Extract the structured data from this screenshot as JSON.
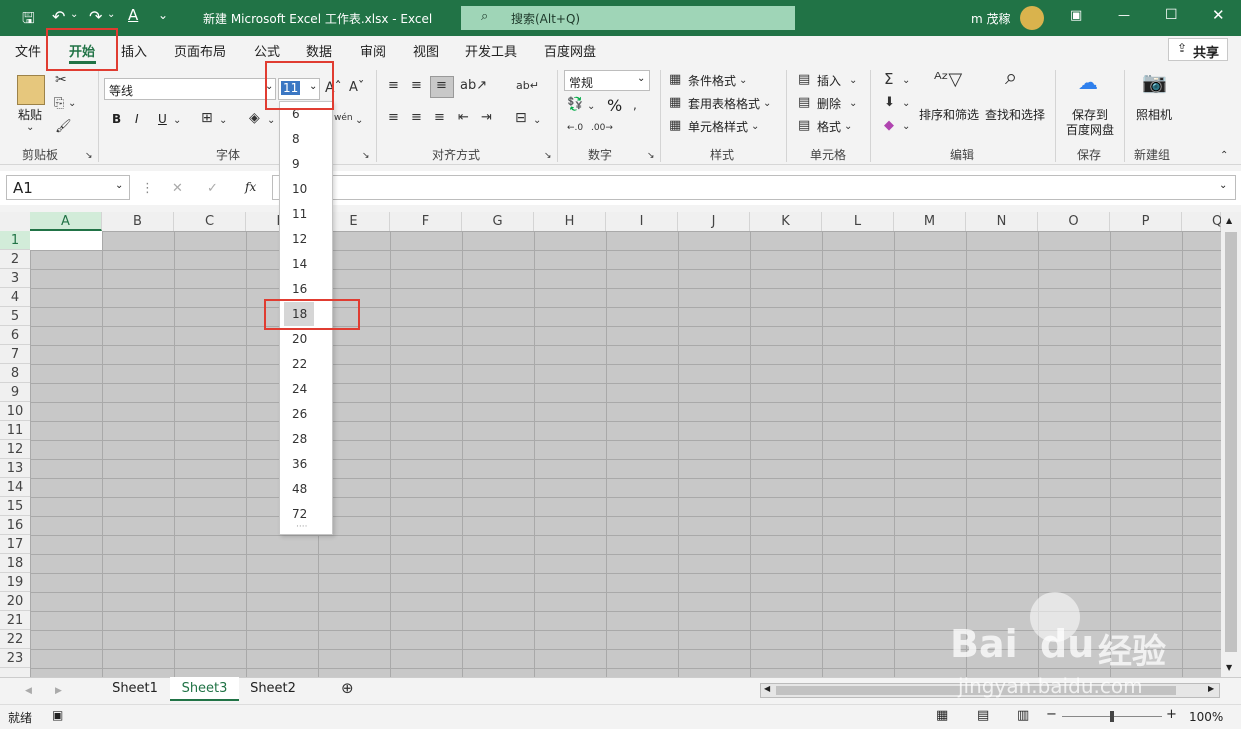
{
  "titlebar": {
    "title": "新建 Microsoft Excel 工作表.xlsx  -  Excel",
    "search_placeholder": "搜索(Alt+Q)",
    "user": "m 茂稼"
  },
  "menu": {
    "tabs": [
      "文件",
      "开始",
      "插入",
      "页面布局",
      "公式",
      "数据",
      "审阅",
      "视图",
      "开发工具",
      "百度网盘"
    ],
    "active": "开始",
    "share": "共享"
  },
  "ribbon": {
    "clipboard": {
      "paste": "粘贴",
      "group": "剪贴板"
    },
    "font": {
      "name": "等线",
      "size": "11",
      "group": "字体",
      "bold": "B",
      "italic": "I",
      "underline": "U"
    },
    "align": {
      "group": "对齐方式"
    },
    "number": {
      "format": "常规",
      "group": "数字",
      "percent": "%"
    },
    "styles": {
      "conditional": "条件格式",
      "table": "套用表格格式",
      "cell": "单元格样式",
      "group": "样式"
    },
    "cells": {
      "insert": "插入",
      "delete": "删除",
      "format": "格式",
      "group": "单元格"
    },
    "editing": {
      "sort": "排序和筛选",
      "find": "查找和选择",
      "group": "编辑"
    },
    "save": {
      "label1": "保存到",
      "label2": "百度网盘",
      "group": "保存"
    },
    "camera": {
      "label": "照相机",
      "group": "新建组"
    }
  },
  "formula": {
    "namebox": "A1",
    "fx": "fx"
  },
  "grid": {
    "columns": [
      "A",
      "B",
      "C",
      "D",
      "E",
      "F",
      "G",
      "H",
      "I",
      "J",
      "K",
      "L",
      "M",
      "N",
      "O",
      "P",
      "Q"
    ],
    "rows": [
      "1",
      "2",
      "3",
      "4",
      "5",
      "6",
      "7",
      "8",
      "9",
      "10",
      "11",
      "12",
      "13",
      "14",
      "15",
      "16",
      "17",
      "18",
      "19",
      "20",
      "21",
      "22",
      "23"
    ]
  },
  "font_size_dropdown": {
    "options": [
      "6",
      "8",
      "9",
      "10",
      "11",
      "12",
      "14",
      "16",
      "18",
      "20",
      "22",
      "24",
      "26",
      "28",
      "36",
      "48",
      "72"
    ],
    "highlighted": "18"
  },
  "sheets": {
    "tabs": [
      "Sheet1",
      "Sheet3",
      "Sheet2"
    ],
    "active": "Sheet3"
  },
  "status": {
    "ready": "就绪",
    "zoom": "100%"
  },
  "watermark": {
    "brand": "Bai",
    "brand2": "du",
    "jingyan": "经验",
    "url": "jingyan.baidu.com"
  },
  "colors": {
    "excel_green": "#217346",
    "highlight_red": "#e03c31"
  }
}
